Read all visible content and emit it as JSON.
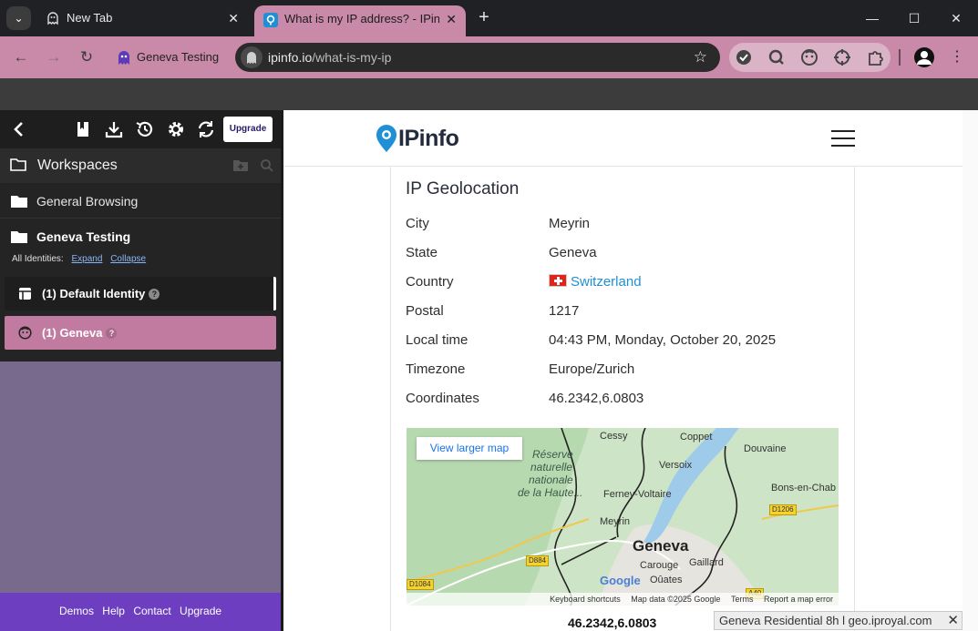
{
  "browser": {
    "tabs": [
      {
        "label": "New Tab",
        "close": "✕"
      },
      {
        "label": "What is my IP address? - IPinfo",
        "close": "✕"
      }
    ],
    "new_tab": "+",
    "window_controls": {
      "minimize": "—",
      "maximize": "☐",
      "close": "✕"
    },
    "profile_label": "Geneva Testing",
    "address": {
      "host": "ipinfo.io",
      "path": "/what-is-my-ip"
    },
    "icons": [
      "back-icon",
      "forward-icon",
      "reload-icon",
      "star-icon",
      "extensions-icon",
      "account-icon",
      "menu-icon"
    ]
  },
  "sidebar": {
    "upgrade_button": "Upgrade",
    "workspaces_title": "Workspaces",
    "workspaces": [
      {
        "label": "General Browsing"
      },
      {
        "label": "Geneva Testing"
      }
    ],
    "identities_label": "All Identities:",
    "expand": "Expand",
    "collapse": "Collapse",
    "identities": [
      {
        "label": "(1) Default Identity",
        "help": "?"
      },
      {
        "label": "(1) Geneva",
        "help": "?"
      }
    ],
    "footer": [
      "Demos",
      "Help",
      "Contact",
      "Upgrade"
    ],
    "colors": {
      "active_identity": "#c27ba0",
      "footer": "#6d3fc0",
      "fill": "#776a8c"
    }
  },
  "page": {
    "logo_text": "IPinfo",
    "section_title": "IP Geolocation",
    "rows": [
      {
        "key": "City",
        "value": "Meyrin"
      },
      {
        "key": "State",
        "value": "Geneva"
      },
      {
        "key": "Country",
        "value": "Switzerland"
      },
      {
        "key": "Postal",
        "value": "1217"
      },
      {
        "key": "Local time",
        "value": "04:43 PM, Monday, October 20, 2025"
      },
      {
        "key": "Timezone",
        "value": "Europe/Zurich"
      },
      {
        "key": "Coordinates",
        "value": "46.2342,6.0803"
      }
    ],
    "map": {
      "view_larger": "View larger map",
      "labels": [
        "Cessy",
        "Coppet",
        "Douvaine",
        "Versoix",
        "Réserve",
        "naturelle",
        "nationale",
        "de la Haute...",
        "Ferney-Voltaire",
        "Bons-en-Chab",
        "Meyrin",
        "Geneva",
        "Carouge",
        "Gaillard",
        "Oûates"
      ],
      "road_signs": [
        "D1206",
        "D884",
        "D1084",
        "A40"
      ],
      "attribution": [
        "Keyboard shortcuts",
        "Map data ©2025 Google",
        "Terms",
        "Report a map error"
      ],
      "google": "Google"
    },
    "coords_caption": "46.2342,6.0803"
  },
  "status": {
    "text": "Geneva Residential 8h l geo.iproyal.com",
    "close": "✕"
  }
}
